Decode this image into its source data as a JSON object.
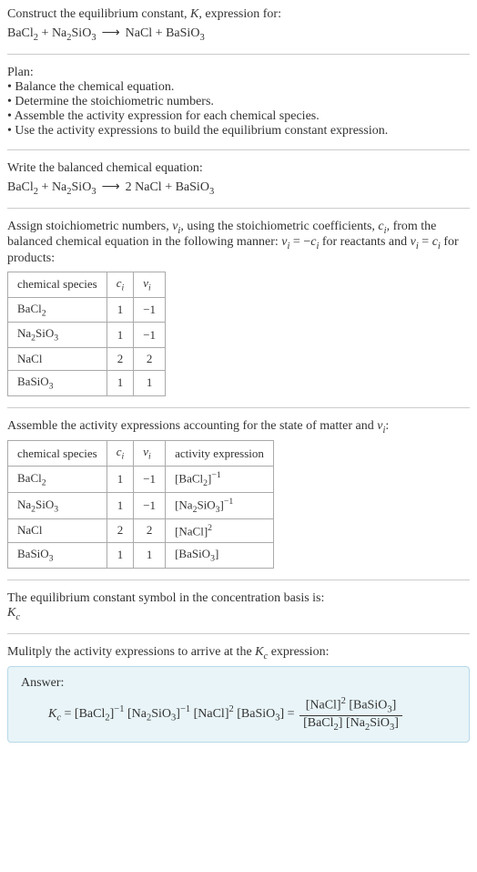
{
  "header": {
    "prompt_line1": "Construct the equilibrium constant, ",
    "prompt_K": "K",
    "prompt_line1b": ", expression for:",
    "eq_lhs_a": "BaCl",
    "eq_lhs_a_sub": "2",
    "eq_plus1": " + ",
    "eq_lhs_b": "Na",
    "eq_lhs_b_sub": "2",
    "eq_lhs_c": "SiO",
    "eq_lhs_c_sub": "3",
    "eq_arrow": "⟶",
    "eq_rhs_a": "NaCl + BaSiO",
    "eq_rhs_a_sub": "3"
  },
  "plan": {
    "title": "Plan:",
    "b1": "• Balance the chemical equation.",
    "b2": "• Determine the stoichiometric numbers.",
    "b3": "• Assemble the activity expression for each chemical species.",
    "b4": "• Use the activity expressions to build the equilibrium constant expression."
  },
  "balanced": {
    "title": "Write the balanced chemical equation:",
    "lhs_a": "BaCl",
    "lhs_a_sub": "2",
    "plus1": " + ",
    "lhs_b": "Na",
    "lhs_b_sub": "2",
    "lhs_c": "SiO",
    "lhs_c_sub": "3",
    "arrow": "⟶",
    "rhs": "2 NaCl + BaSiO",
    "rhs_sub": "3"
  },
  "assign": {
    "text1": "Assign stoichiometric numbers, ",
    "nu": "ν",
    "sub_i": "i",
    "text2": ", using the stoichiometric coefficients, ",
    "c": "c",
    "text3": ", from the balanced chemical equation in the following manner: ",
    "eq1a": "ν",
    "eq1b": " = −",
    "eq1c": "c",
    "text4": " for reactants and ",
    "eq2a": "ν",
    "eq2b": " = ",
    "eq2c": "c",
    "text5": " for products:"
  },
  "table1": {
    "h1": "chemical species",
    "h2": "c",
    "h2_sub": "i",
    "h3": "ν",
    "h3_sub": "i",
    "rows": [
      {
        "species_a": "BaCl",
        "species_sub": "2",
        "species_b": "",
        "c": "1",
        "nu": "−1"
      },
      {
        "species_a": "Na",
        "species_sub": "2",
        "species_b": "SiO",
        "species_sub2": "3",
        "c": "1",
        "nu": "−1"
      },
      {
        "species_a": "NaCl",
        "species_sub": "",
        "species_b": "",
        "c": "2",
        "nu": "2"
      },
      {
        "species_a": "BaSiO",
        "species_sub": "3",
        "species_b": "",
        "c": "1",
        "nu": "1"
      }
    ]
  },
  "assemble": {
    "text1": "Assemble the activity expressions accounting for the state of matter and ",
    "nu": "ν",
    "sub_i": "i",
    "text2": ":"
  },
  "table2": {
    "h1": "chemical species",
    "h2": "c",
    "h2_sub": "i",
    "h3": "ν",
    "h3_sub": "i",
    "h4": "activity expression",
    "rows": [
      {
        "sp_a": "BaCl",
        "sp_sub": "2",
        "sp_b": "",
        "c": "1",
        "nu": "−1",
        "act_a": "[BaCl",
        "act_sub": "2",
        "act_b": "]",
        "act_sup": "−1"
      },
      {
        "sp_a": "Na",
        "sp_sub": "2",
        "sp_b": "SiO",
        "sp_sub2": "3",
        "c": "1",
        "nu": "−1",
        "act_a": "[Na",
        "act_sub": "2",
        "act_b": "SiO",
        "act_sub2": "3",
        "act_c": "]",
        "act_sup": "−1"
      },
      {
        "sp_a": "NaCl",
        "sp_sub": "",
        "sp_b": "",
        "c": "2",
        "nu": "2",
        "act_a": "[NaCl]",
        "act_sup": "2"
      },
      {
        "sp_a": "BaSiO",
        "sp_sub": "3",
        "sp_b": "",
        "c": "1",
        "nu": "1",
        "act_a": "[BaSiO",
        "act_sub": "3",
        "act_b": "]"
      }
    ]
  },
  "symbol": {
    "text": "The equilibrium constant symbol in the concentration basis is:",
    "K": "K",
    "K_sub": "c"
  },
  "multiply": {
    "text1": "Mulitply the activity expressions to arrive at the ",
    "K": "K",
    "K_sub": "c",
    "text2": " expression:"
  },
  "answer": {
    "label": "Answer:",
    "Kc": "K",
    "Kc_sub": "c",
    "eq": " = ",
    "t1": "[BaCl",
    "t1_sub": "2",
    "t1b": "]",
    "t1_sup": "−1",
    "sp1": " ",
    "t2": "[Na",
    "t2_sub": "2",
    "t2b": "SiO",
    "t2_sub2": "3",
    "t2c": "]",
    "t2_sup": "−1",
    "sp2": " ",
    "t3": "[NaCl]",
    "t3_sup": "2",
    "sp3": " ",
    "t4": "[BaSiO",
    "t4_sub": "3",
    "t4b": "] = ",
    "num1": "[NaCl]",
    "num1_sup": "2",
    "num_sp": " ",
    "num2": "[BaSiO",
    "num2_sub": "3",
    "num2b": "]",
    "den1": "[BaCl",
    "den1_sub": "2",
    "den1b": "] ",
    "den2": "[Na",
    "den2_sub": "2",
    "den2b": "SiO",
    "den2_sub2": "3",
    "den2c": "]"
  }
}
